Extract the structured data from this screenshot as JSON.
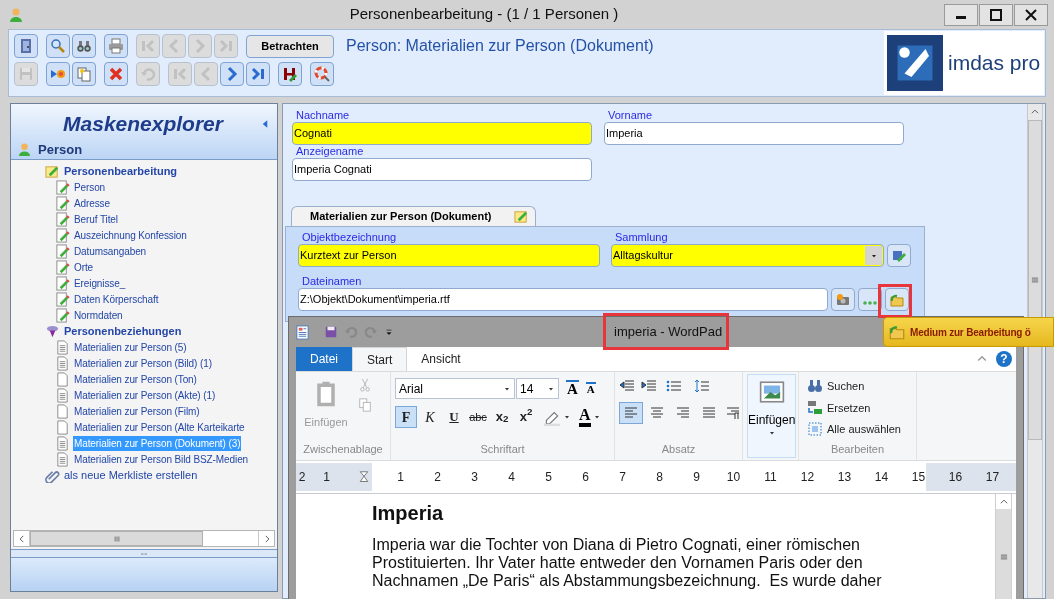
{
  "window": {
    "title": "Personenbearbeitung - (1 / 1 Personen )"
  },
  "toolbar": {
    "rows": [
      {
        "groups": [
          [
            {
              "disabled": false
            }
          ],
          [
            {
              "disabled": false
            },
            {
              "disabled": false
            }
          ],
          [
            {
              "disabled": false
            }
          ],
          [
            {
              "disabled": true
            },
            {
              "disabled": true
            },
            {
              "disabled": true
            },
            {
              "disabled": true
            }
          ]
        ],
        "text_button": "Betrachten"
      },
      {
        "groups": [
          [
            {
              "disabled": true
            }
          ],
          [
            {
              "disabled": false
            },
            {
              "disabled": false
            }
          ],
          [
            {
              "disabled": false
            }
          ],
          [
            {
              "disabled": true
            }
          ],
          [
            {
              "disabled": true
            },
            {
              "disabled": true
            },
            {
              "disabled": false
            },
            {
              "disabled": false
            }
          ],
          [
            {
              "disabled": false
            }
          ],
          [
            {
              "disabled": false
            }
          ]
        ]
      }
    ],
    "heading": "Person: Materialien zur Person (Dokument)"
  },
  "logo": {
    "text": "imdas pro"
  },
  "sidebar": {
    "title": "Maskenexplorer",
    "section": "Person",
    "tree": [
      {
        "label": "Personenbearbeitung",
        "kind": "forms",
        "children": [
          {
            "label": "Person",
            "kind": "form",
            "selected": false
          },
          {
            "label": "Adresse",
            "kind": "form",
            "selected": false
          },
          {
            "label": "Beruf Titel",
            "kind": "form",
            "selected": false
          },
          {
            "label": "Auszeichnung Konfession",
            "kind": "form",
            "selected": false
          },
          {
            "label": "Datumsangaben",
            "kind": "form",
            "selected": false
          },
          {
            "label": "Orte",
            "kind": "form",
            "selected": false
          },
          {
            "label": "Ereignisse_",
            "kind": "form",
            "selected": false
          },
          {
            "label": "Daten Körperschaft",
            "kind": "form",
            "selected": false
          },
          {
            "label": "Normdaten",
            "kind": "form",
            "selected": false
          }
        ]
      },
      {
        "label": "Personenbeziehungen",
        "kind": "relations",
        "children": [
          {
            "label": "Materialien zur Person (5)",
            "kind": "filled",
            "selected": false
          },
          {
            "label": "Materialien zur Person (Bild) (1)",
            "kind": "filled",
            "selected": false
          },
          {
            "label": "Materialien zur Person (Ton)",
            "kind": "empty",
            "selected": false
          },
          {
            "label": "Materialien zur Person (Akte) (1)",
            "kind": "filled",
            "selected": false
          },
          {
            "label": "Materialien zur Person (Film)",
            "kind": "empty",
            "selected": false
          },
          {
            "label": "Materialien zur Person (Alte Karteikarte",
            "kind": "empty",
            "selected": false
          },
          {
            "label": "Materialien zur Person (Dokument) (3)",
            "kind": "filled",
            "selected": true
          },
          {
            "label": "Materialien zur Person Bild BSZ-Medien",
            "kind": "filled",
            "selected": false
          }
        ]
      },
      {
        "label": "als neue Merkliste erstellen",
        "kind": "clip"
      }
    ]
  },
  "form": {
    "fields": [
      {
        "label": "Nachname",
        "value": "Cognati",
        "required": true
      },
      {
        "label": "Vorname",
        "value": "Imperia",
        "required": false
      },
      {
        "label": "Anzeigename",
        "value": "Imperia Cognati",
        "required": false
      }
    ],
    "tabs": [
      {
        "label": "Materialien zur Person (Dokument)",
        "selected": true
      }
    ],
    "tab_fields": [
      {
        "kind": "text",
        "label": "Objektbezeichnung",
        "value": "Kurztext zur Person",
        "required": true
      },
      {
        "kind": "dropdown",
        "label": "Sammlung",
        "value": "Alltagskultur",
        "required": true
      },
      {
        "kind": "file",
        "label": "Dateinamen",
        "value": "Z:\\Objekt\\Dokument\\imperia.rtf",
        "required": false
      }
    ]
  },
  "tooltip": {
    "text": "Medium zur Bearbeitung ö"
  },
  "wordpad": {
    "title": "imperia - WordPad",
    "tabs": [
      {
        "label": "Datei",
        "kind": "file",
        "selected": false
      },
      {
        "label": "Start",
        "kind": "tab",
        "selected": true
      },
      {
        "label": "Ansicht",
        "kind": "tab",
        "selected": false
      }
    ],
    "help": "?",
    "clipboard": {
      "label": "Zwischenablage",
      "paste": "Einfügen",
      "disabled": true
    },
    "font": {
      "label": "Schriftart",
      "family": "Arial",
      "size": "14",
      "grow": "A",
      "shrink": "A",
      "color_letter": "A",
      "styles": [
        {
          "text": "F",
          "selected": true
        },
        {
          "text": "K",
          "selected": false
        },
        {
          "text": "U",
          "selected": false
        },
        {
          "text": "abc",
          "selected": false
        },
        {
          "text": "x$_{2}$",
          "selected": false
        },
        {
          "text": "x$^{2}$",
          "selected": false
        }
      ]
    },
    "paragraph": {
      "label": "Absatz",
      "align": [
        {
          "selected": true
        },
        {
          "selected": false
        },
        {
          "selected": false
        },
        {
          "selected": false
        }
      ]
    },
    "insert": {
      "label": "Einfügen"
    },
    "editing": {
      "label": "Bearbeiten",
      "items": [
        "Suchen",
        "Ersetzen",
        "Alle auswählen"
      ]
    },
    "ruler": [
      "2",
      "1",
      "1",
      "2",
      "3",
      "4",
      "5",
      "6",
      "7",
      "8",
      "9",
      "10",
      "11",
      "12",
      "13",
      "14",
      "15",
      "16",
      "17"
    ],
    "document": {
      "heading": "Imperia",
      "lines": [
        "Imperia war die Tochter von Diana di Pietro Cognati, einer römischen",
        "Prostituierten. Ihr Vater hatte entweder den Vornamen Paris oder den",
        "Nachnamen „De Paris“ als Abstammungsbezeichnung.  Es wurde daher"
      ]
    }
  }
}
